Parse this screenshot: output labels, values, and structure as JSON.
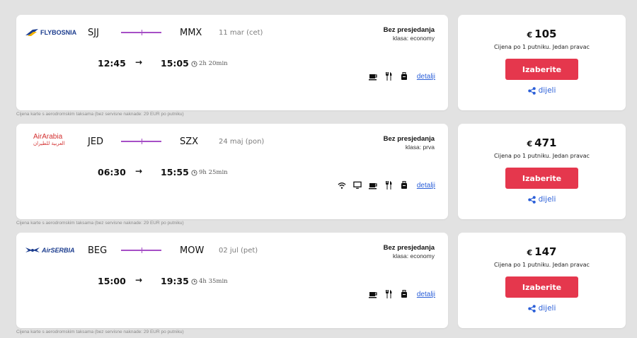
{
  "flights": [
    {
      "airline": "FLYBOSNIA",
      "airline_color": "#1b3c8e",
      "from": "SJJ",
      "to": "MMX",
      "date": "11 mar (cet)",
      "stops": "Bez presjedanja",
      "class": "klasa: economy",
      "depart": "12:45",
      "arrive": "15:05",
      "duration": "2h 20min",
      "amenities": [
        "coffee-icon",
        "cutlery-icon",
        "baggage-icon"
      ],
      "details": "detalji",
      "currency": "€",
      "price": "105",
      "price_note": "Cijena po 1 putniku. Jedan pravac",
      "select": "Izaberite",
      "share": "dijeli",
      "footnote": "Cijena karte s aerodromskim taksama (bez servisne naknade: 29 EUR po putniku)"
    },
    {
      "airline": "AirArabia",
      "airline_sub": "العربية للطيران",
      "airline_color": "#d32f2f",
      "from": "JED",
      "to": "SZX",
      "date": "24 maj (pon)",
      "stops": "Bez presjedanja",
      "class": "klasa: prva",
      "depart": "06:30",
      "arrive": "15:55",
      "duration": "9h 25min",
      "amenities": [
        "wifi-icon",
        "screen-icon",
        "coffee-icon",
        "cutlery-icon",
        "baggage-icon"
      ],
      "details": "detalji",
      "currency": "€",
      "price": "471",
      "price_note": "Cijena po 1 putniku. Jedan pravac",
      "select": "Izaberite",
      "share": "dijeli",
      "footnote": "Cijena karte s aerodromskim taksama (bez servisne naknade: 29 EUR po putniku)"
    },
    {
      "airline": "AirSERBIA",
      "airline_color": "#1b3c8e",
      "from": "BEG",
      "to": "MOW",
      "date": "02 jul (pet)",
      "stops": "Bez presjedanja",
      "class": "klasa: economy",
      "depart": "15:00",
      "arrive": "19:35",
      "duration": "4h 35min",
      "amenities": [
        "coffee-icon",
        "cutlery-icon",
        "baggage-icon"
      ],
      "details": "detalji",
      "currency": "€",
      "price": "147",
      "price_note": "Cijena po 1 putniku. Jedan pravac",
      "select": "Izaberite",
      "share": "dijeli",
      "footnote": "Cijena karte s aerodromskim taksama (bez servisne naknade: 29 EUR po putniku)"
    }
  ],
  "colors": {
    "accent": "#e5374d",
    "link": "#2b5fd8",
    "route": "#a64fc6",
    "background": "#e2e2e2"
  }
}
